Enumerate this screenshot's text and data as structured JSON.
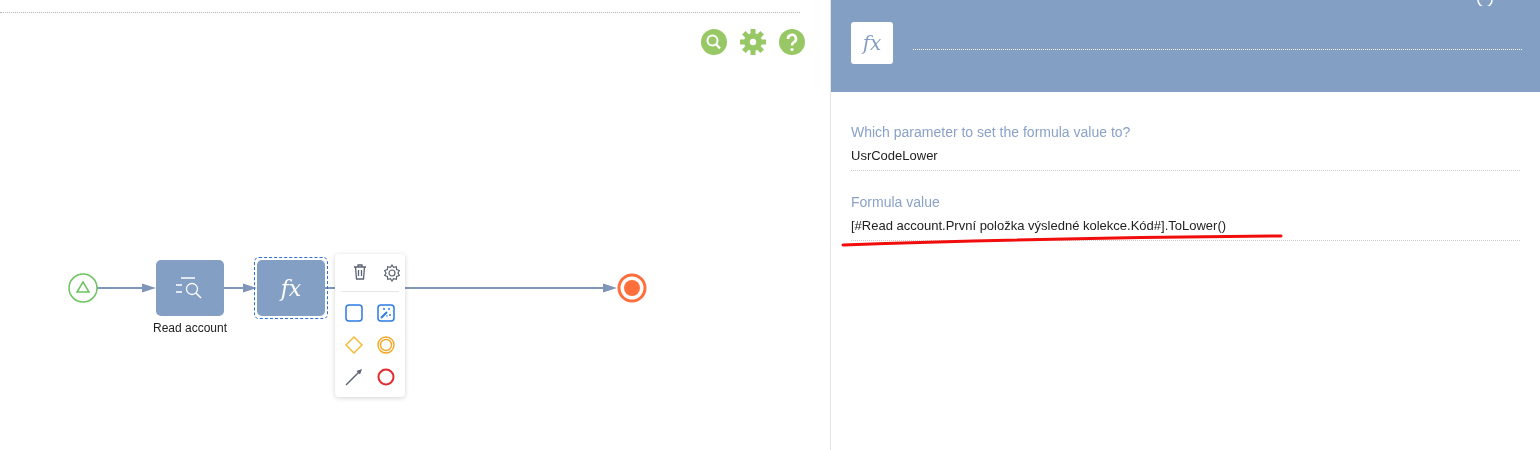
{
  "toolbar": {
    "buttons": [
      {
        "kind": "search"
      },
      {
        "kind": "settings"
      },
      {
        "kind": "help"
      }
    ]
  },
  "diagram": {
    "nodes": [
      {
        "kind": "start"
      },
      {
        "kind": "read",
        "label": "Read account",
        "selected": false
      },
      {
        "kind": "formula",
        "icon_text": "fx",
        "selected": true
      },
      {
        "kind": "end"
      }
    ]
  },
  "context_menu": {
    "actions": [
      {
        "kind": "delete"
      },
      {
        "kind": "settings"
      }
    ],
    "tools": [
      {
        "kind": "task"
      },
      {
        "kind": "script"
      },
      {
        "kind": "gateway"
      },
      {
        "kind": "intermediate"
      },
      {
        "kind": "flow"
      },
      {
        "kind": "end"
      }
    ]
  },
  "panel": {
    "icon_text": "fx",
    "fields": [
      {
        "label": "Which parameter to set the formula value to?",
        "value": "UsrCodeLower",
        "underlined": false
      },
      {
        "label": "Formula value",
        "value": "[#Read account.První položka výsledné kolekce.Kód#].ToLower()",
        "underlined": true
      }
    ]
  }
}
